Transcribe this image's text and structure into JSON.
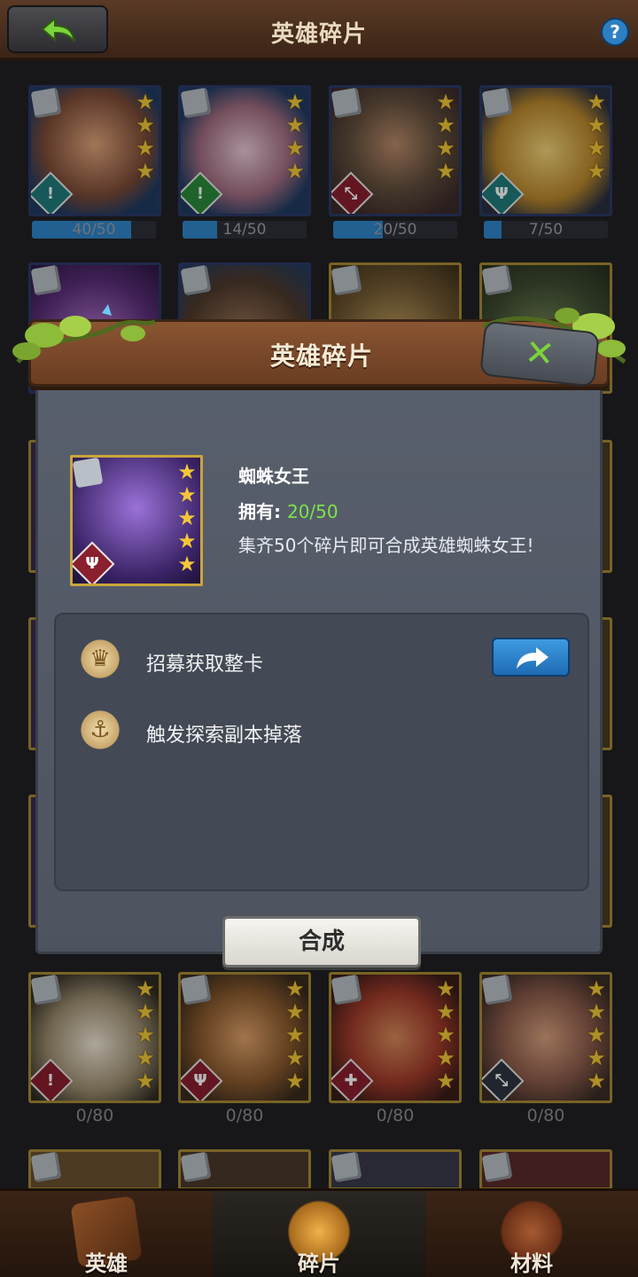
{
  "header": {
    "title": "英雄碎片",
    "help_label": "?"
  },
  "grid": {
    "row1": [
      {
        "progress": "40/50",
        "fill": 0.8,
        "role": "!",
        "role_color": "#1f7c7a"
      },
      {
        "progress": "14/50",
        "fill": 0.28,
        "role": "!",
        "role_color": "#2a8a3a"
      },
      {
        "progress": "20/50",
        "fill": 0.4,
        "role": "⤡",
        "role_color": "#8a1f2e"
      },
      {
        "progress": "7/50",
        "fill": 0.14,
        "role": "Ψ",
        "role_color": "#1f7c7a"
      }
    ],
    "row_bottom": [
      {
        "count": "0/80",
        "role": "!",
        "role_color": "#8a1f2e"
      },
      {
        "count": "0/80",
        "role": "Ψ",
        "role_color": "#8a1f2e"
      },
      {
        "count": "0/80",
        "role": "✚",
        "role_color": "#8a1f2e"
      },
      {
        "count": "0/80",
        "role": "⤡",
        "role_color": "#2d3440"
      }
    ]
  },
  "modal": {
    "title": "英雄碎片",
    "close_label": "✕",
    "hero_name": "蜘蛛女王",
    "own_label": "拥有: ",
    "own_value": "20/50",
    "description": "集齐50个碎片即可合成英雄蜘蛛女王!",
    "hero_role": "Ψ",
    "sources": [
      {
        "label": "招募获取整卡",
        "icon": "recruit-icon"
      },
      {
        "label": "触发探索副本掉落",
        "icon": "explore-icon"
      }
    ],
    "compose_label": "合成"
  },
  "nav": {
    "items": [
      {
        "label": "英雄"
      },
      {
        "label": "碎片"
      },
      {
        "label": "材料"
      }
    ]
  },
  "colors": {
    "accent_green": "#7be34a",
    "progress_blue": "#2f86c9",
    "star_gold": "#f2c838"
  }
}
